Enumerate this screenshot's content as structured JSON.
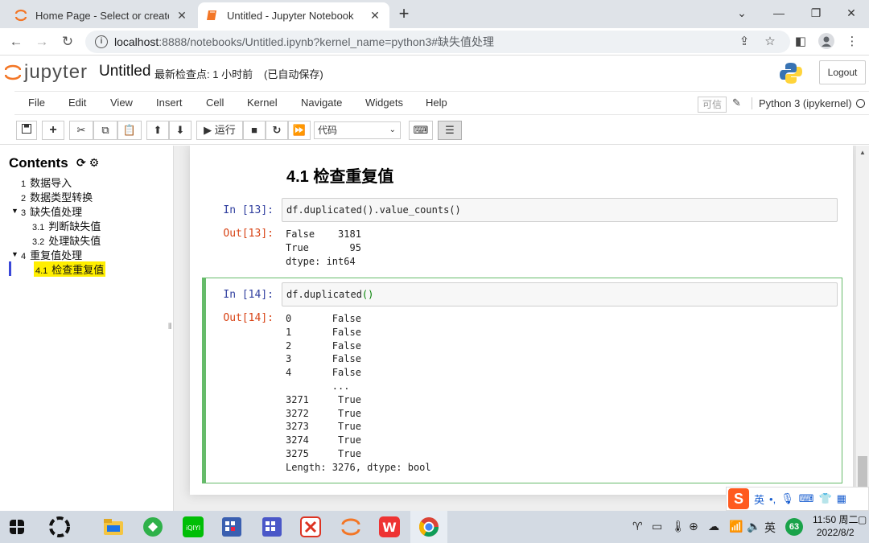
{
  "browser": {
    "tabs": [
      {
        "title": "Home Page - Select or create a",
        "active": false
      },
      {
        "title": "Untitled - Jupyter Notebook",
        "active": true
      }
    ],
    "url_host": "localhost",
    "url_rest": ":8888/notebooks/Untitled.ipynb?kernel_name=python3#缺失值处理"
  },
  "jupyter": {
    "logo_text": "jupyter",
    "notebook_name": "Untitled",
    "checkpoint": "最新检查点: 1 小时前",
    "autosave": "(已自动保存)",
    "logout_label": "Logout",
    "menu": [
      "File",
      "Edit",
      "View",
      "Insert",
      "Cell",
      "Kernel",
      "Navigate",
      "Widgets",
      "Help"
    ],
    "trusted": "可信",
    "kernel": "Python 3 (ipykernel)",
    "run_label": "运行",
    "cell_type": "代码"
  },
  "toc": {
    "title": "Contents",
    "items": [
      {
        "num": "1",
        "label": "数据导入"
      },
      {
        "num": "2",
        "label": "数据类型转换"
      },
      {
        "num": "3",
        "label": "缺失值处理"
      },
      {
        "num": "3.1",
        "label": "判断缺失值"
      },
      {
        "num": "3.2",
        "label": "处理缺失值"
      },
      {
        "num": "4",
        "label": "重复值处理"
      },
      {
        "num": "4.1",
        "label": "检查重复值"
      }
    ]
  },
  "notebook": {
    "heading": "4.1  检查重复值",
    "cells": [
      {
        "in_prompt": "In  [13]:",
        "code": "df.duplicated().value_counts()",
        "out_prompt": "Out[13]:",
        "output": "False    3181\nTrue       95\ndtype: int64"
      },
      {
        "in_prompt": "In  [14]:",
        "code_main": "df.duplicated",
        "code_paren": "()",
        "out_prompt": "Out[14]:",
        "output": "0       False\n1       False\n2       False\n3       False\n4       False\n        ...  \n3271     True\n3272     True\n3273     True\n3274     True\n3275     True\nLength: 3276, dtype: bool"
      }
    ]
  },
  "ime": {
    "lang": "英",
    "punct": "•,"
  },
  "taskbar": {
    "tray_lang": "英",
    "badge": "63",
    "time": "11:50 周二",
    "date": "2022/8/2"
  }
}
